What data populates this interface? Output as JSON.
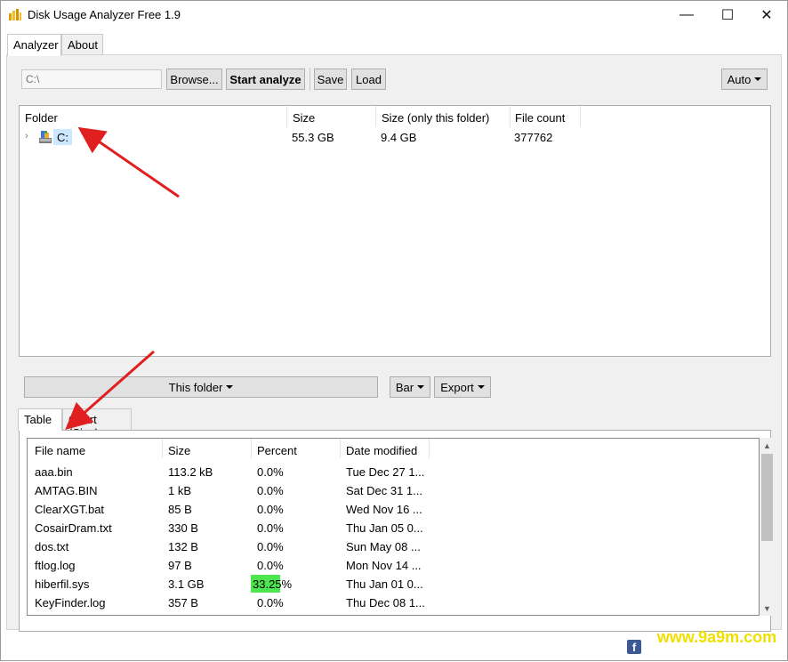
{
  "window": {
    "title": "Disk Usage Analyzer Free 1.9",
    "min_glyph": "—",
    "max_glyph": "☐",
    "close_glyph": "✕"
  },
  "tabs_top": [
    {
      "label": "Analyzer",
      "active": true
    },
    {
      "label": "About",
      "active": false
    }
  ],
  "toolbar": {
    "path_placeholder": "C:\\",
    "browse_label": "Browse...",
    "start_label": "Start analyze",
    "save_label": "Save",
    "load_label": "Load",
    "auto_label": "Auto"
  },
  "tree": {
    "headers": [
      "Folder",
      "Size",
      "Size (only this folder)",
      "File count"
    ],
    "rows": [
      {
        "name": "C:",
        "size": "55.3 GB",
        "size_only": "9.4 GB",
        "file_count": "377762"
      }
    ]
  },
  "mid": {
    "this_folder_label": "This folder",
    "bar_label": "Bar",
    "export_label": "Export"
  },
  "tabs_bottom": [
    {
      "label": "Table",
      "active": true
    },
    {
      "label": "Chart (Size)",
      "active": false
    }
  ],
  "table": {
    "headers": [
      "File name",
      "Size",
      "Percent",
      "Date modified"
    ],
    "rows": [
      {
        "name": "aaa.bin",
        "size": "113.2 kB",
        "percent": "0.0%",
        "percent_value": 0.0,
        "date": "Tue Dec 27 1..."
      },
      {
        "name": "AMTAG.BIN",
        "size": "1 kB",
        "percent": "0.0%",
        "percent_value": 0.0,
        "date": "Sat Dec 31 1..."
      },
      {
        "name": "ClearXGT.bat",
        "size": "85 B",
        "percent": "0.0%",
        "percent_value": 0.0,
        "date": "Wed Nov 16 ..."
      },
      {
        "name": "CosairDram.txt",
        "size": "330 B",
        "percent": "0.0%",
        "percent_value": 0.0,
        "date": "Thu Jan 05 0..."
      },
      {
        "name": "dos.txt",
        "size": "132 B",
        "percent": "0.0%",
        "percent_value": 0.0,
        "date": "Sun May 08 ..."
      },
      {
        "name": "ftlog.log",
        "size": "97 B",
        "percent": "0.0%",
        "percent_value": 0.0,
        "date": "Mon Nov 14 ..."
      },
      {
        "name": "hiberfil.sys",
        "size": "3.1 GB",
        "percent": "33.25%",
        "percent_value": 33.25,
        "date": "Thu Jan 01 0..."
      },
      {
        "name": "KeyFinder.log",
        "size": "357 B",
        "percent": "0.0%",
        "percent_value": 0.0,
        "date": "Thu Dec 08 1..."
      }
    ]
  },
  "footer": {
    "facebook_glyph": "f",
    "watermark": "www.9a9m.com"
  },
  "colors": {
    "selection": "#cce8ff",
    "percent_bar": "#4ee64e",
    "arrow": "#e02020",
    "watermark": "#f0e000"
  }
}
